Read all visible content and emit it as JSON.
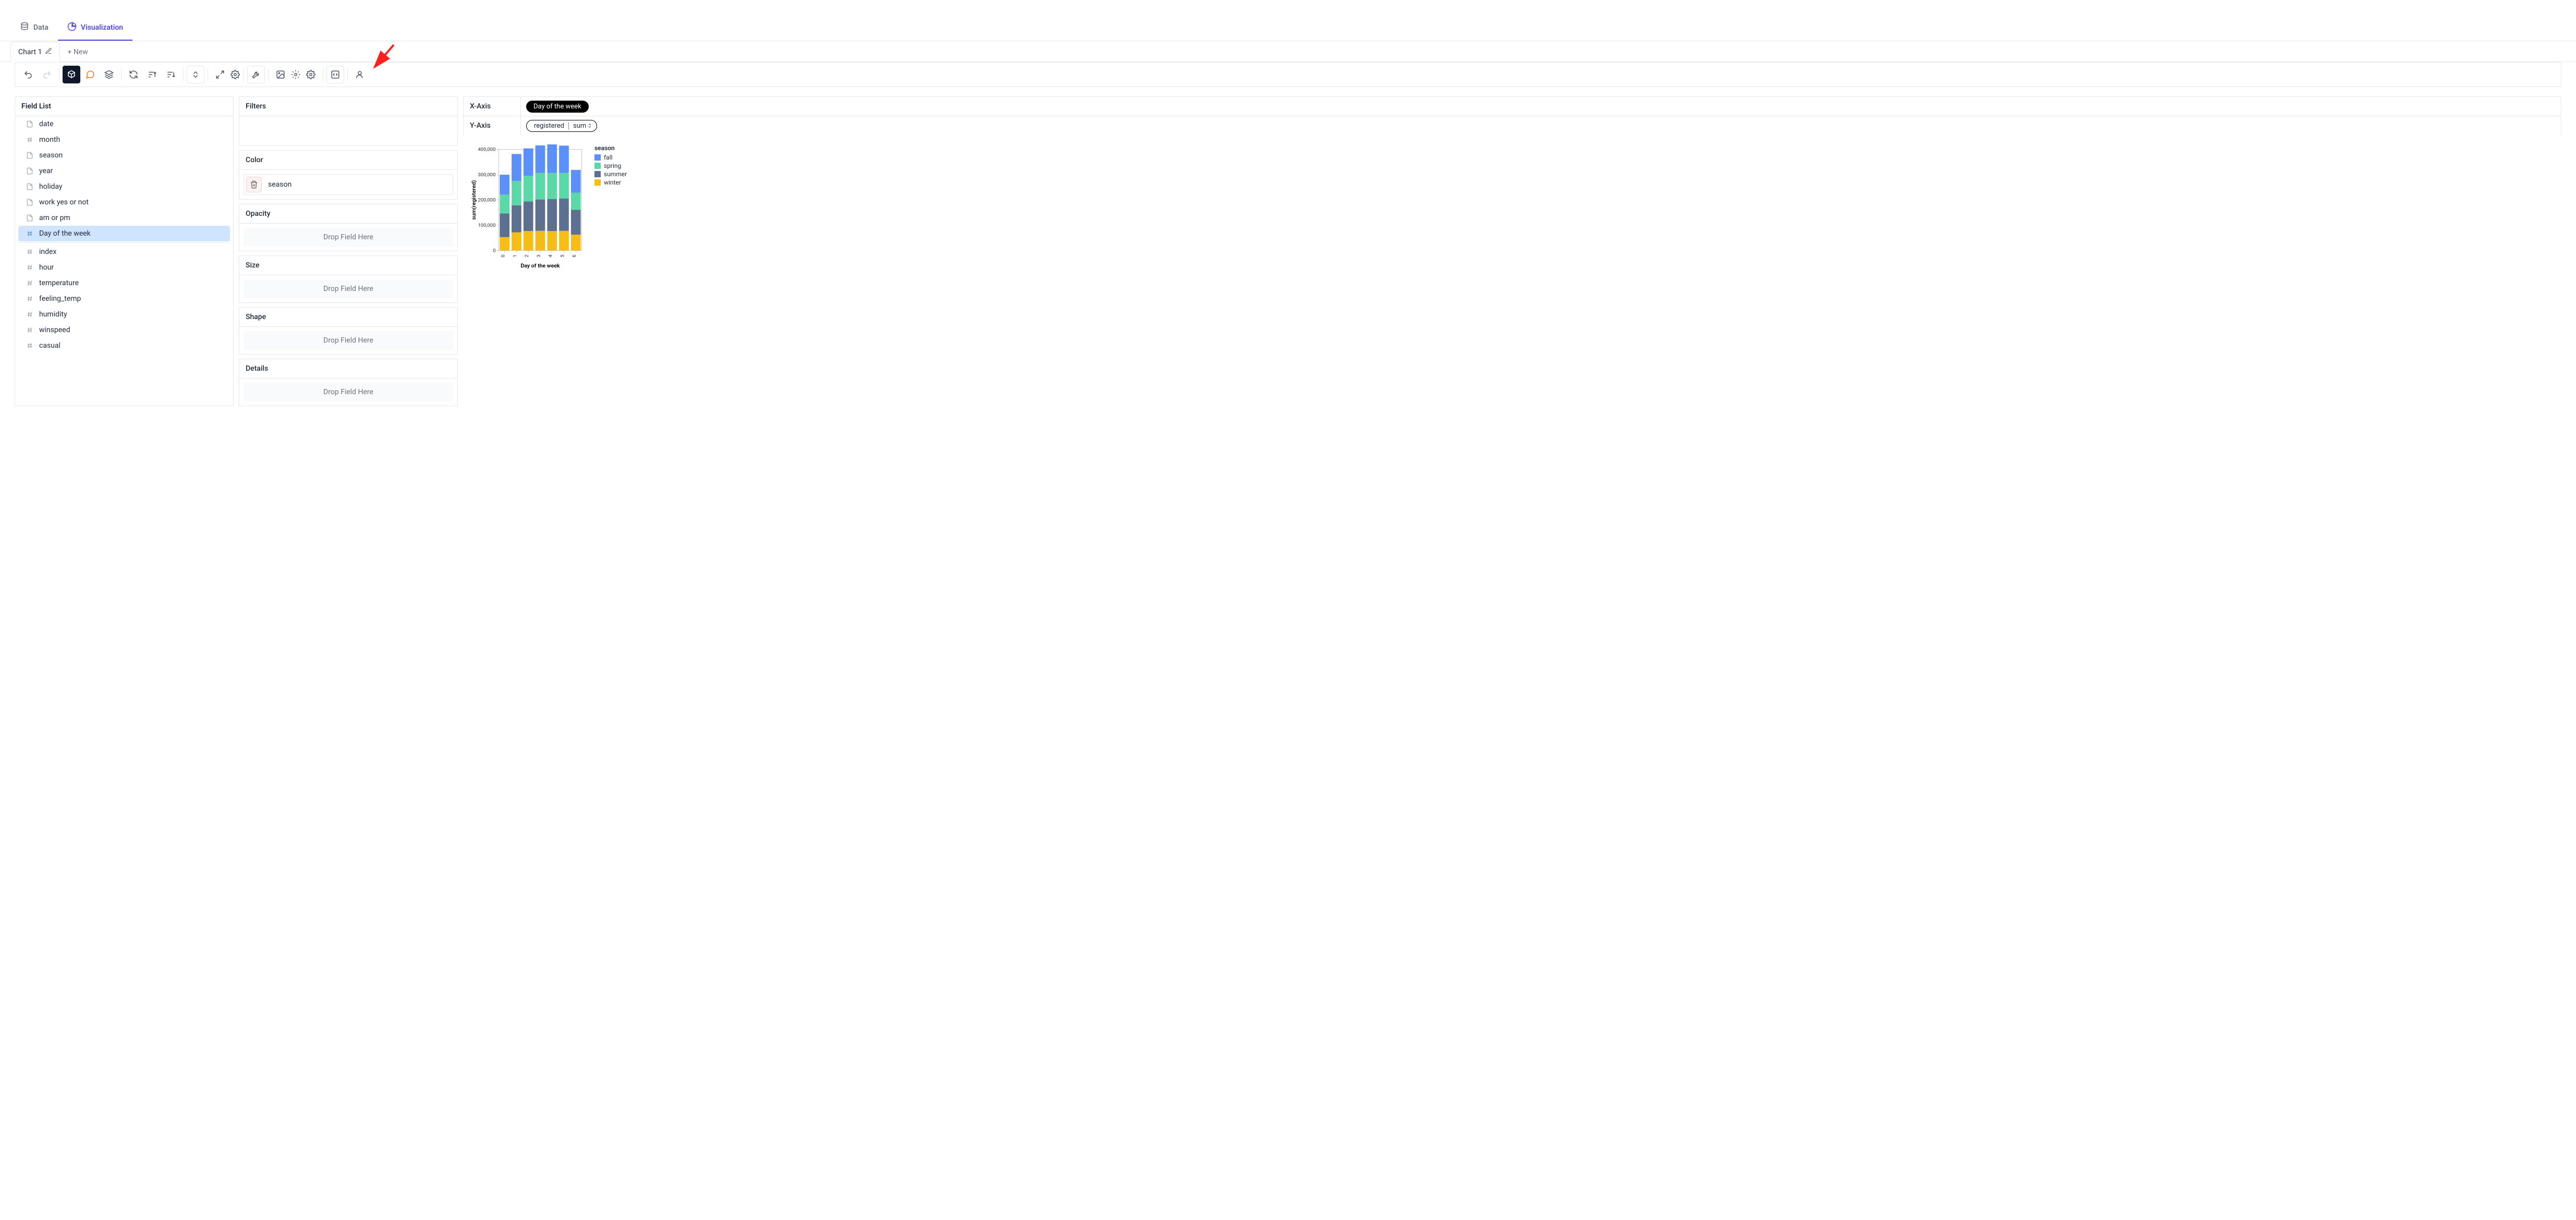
{
  "top_tabs": {
    "data": "Data",
    "visualization": "Visualization"
  },
  "chart_tabs": {
    "chart1": "Chart 1",
    "new": "+ New"
  },
  "field_list": {
    "title": "Field List",
    "items": [
      {
        "name": "date",
        "type": "doc"
      },
      {
        "name": "month",
        "type": "num"
      },
      {
        "name": "season",
        "type": "doc"
      },
      {
        "name": "year",
        "type": "doc"
      },
      {
        "name": "holiday",
        "type": "doc"
      },
      {
        "name": "work yes or not",
        "type": "doc"
      },
      {
        "name": "am or pm",
        "type": "doc"
      },
      {
        "name": "Day of the week",
        "type": "num",
        "highlight": true
      },
      {
        "name": "index",
        "type": "num",
        "divider_before": true
      },
      {
        "name": "hour",
        "type": "num"
      },
      {
        "name": "temperature",
        "type": "num"
      },
      {
        "name": "feeling_temp",
        "type": "num"
      },
      {
        "name": "humidity",
        "type": "num"
      },
      {
        "name": "winspeed",
        "type": "num"
      },
      {
        "name": "casual",
        "type": "num"
      }
    ]
  },
  "shelves": {
    "filters": "Filters",
    "color": {
      "title": "Color",
      "chip": "season"
    },
    "opacity": {
      "title": "Opacity",
      "placeholder": "Drop Field Here"
    },
    "size": {
      "title": "Size",
      "placeholder": "Drop Field Here"
    },
    "shape": {
      "title": "Shape",
      "placeholder": "Drop Field Here"
    },
    "details": {
      "title": "Details",
      "placeholder": "Drop Field Here"
    }
  },
  "axes": {
    "x": {
      "label": "X-Axis",
      "pill": "Day of the week"
    },
    "y": {
      "label": "Y-Axis",
      "pill": "registered",
      "agg": "sum"
    }
  },
  "chart_data": {
    "type": "bar",
    "stacked": true,
    "categories": [
      "0",
      "1",
      "2",
      "3",
      "4",
      "5",
      "6"
    ],
    "series": [
      {
        "name": "fall",
        "color": "#5b8ff9",
        "values": [
          79000,
          107000,
          108000,
          109000,
          120000,
          108000,
          90000
        ]
      },
      {
        "name": "spring",
        "color": "#5ad8a6",
        "values": [
          74000,
          96000,
          102000,
          105000,
          103000,
          101000,
          68000
        ]
      },
      {
        "name": "summer",
        "color": "#5d7092",
        "values": [
          94000,
          107000,
          117000,
          124000,
          127000,
          128000,
          98000
        ]
      },
      {
        "name": "winter",
        "color": "#f6bd16",
        "values": [
          53000,
          72000,
          77000,
          78000,
          77000,
          78000,
          63000
        ]
      }
    ],
    "ylabel": "sum(registered)",
    "xlabel": "Day of the week",
    "legend_title": "season",
    "legend": [
      "fall",
      "spring",
      "summer",
      "winter"
    ],
    "ylim": [
      0,
      400000
    ],
    "yticks": [
      0,
      100000,
      200000,
      300000,
      400000
    ],
    "ytick_labels": [
      "0",
      "100,000",
      "200,000",
      "300,000",
      "400,000"
    ]
  }
}
